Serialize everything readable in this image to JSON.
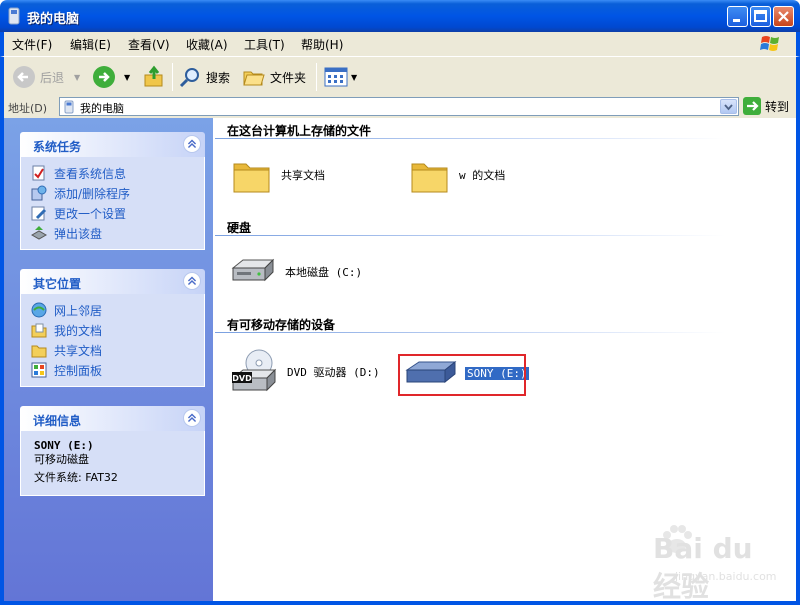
{
  "window": {
    "title": "我的电脑",
    "min_icon": "minimize-icon",
    "max_icon": "maximize-icon",
    "close_icon": "close-icon"
  },
  "menu": {
    "items": [
      "文件(F)",
      "编辑(E)",
      "查看(V)",
      "收藏(A)",
      "工具(T)",
      "帮助(H)"
    ]
  },
  "toolbar": {
    "back_label": "后退",
    "search_label": "搜索",
    "folders_label": "文件夹"
  },
  "address": {
    "label": "地址(D)",
    "value": "我的电脑",
    "go_label": "转到"
  },
  "left_panel": {
    "system_tasks": {
      "title": "系统任务",
      "items": [
        "查看系统信息",
        "添加/删除程序",
        "更改一个设置",
        "弹出该盘"
      ]
    },
    "other_places": {
      "title": "其它位置",
      "items": [
        "网上邻居",
        "我的文档",
        "共享文档",
        "控制面板"
      ]
    },
    "details": {
      "title": "详细信息",
      "name": "SONY (E:)",
      "type": "可移动磁盘",
      "filesystem": "文件系统: FAT32"
    }
  },
  "main": {
    "sections": {
      "files": {
        "title": "在这台计算机上存储的文件",
        "items": [
          "共享文档",
          "w 的文档"
        ]
      },
      "hard_disks": {
        "title": "硬盘",
        "items": [
          "本地磁盘 (C:)"
        ]
      },
      "removable": {
        "title": "有可移动存储的设备",
        "items": [
          "DVD 驱动器 (D:)",
          "SONY (E:)"
        ]
      }
    },
    "dvd_badge": "DVD"
  },
  "watermark": {
    "brand": "Bai du 经验",
    "url": "jingyan.baidu.com"
  },
  "colors": {
    "xp_blue": "#0055e5",
    "link_blue": "#215dc6",
    "selection": "#316ac5",
    "highlight_red": "#e0262a"
  }
}
